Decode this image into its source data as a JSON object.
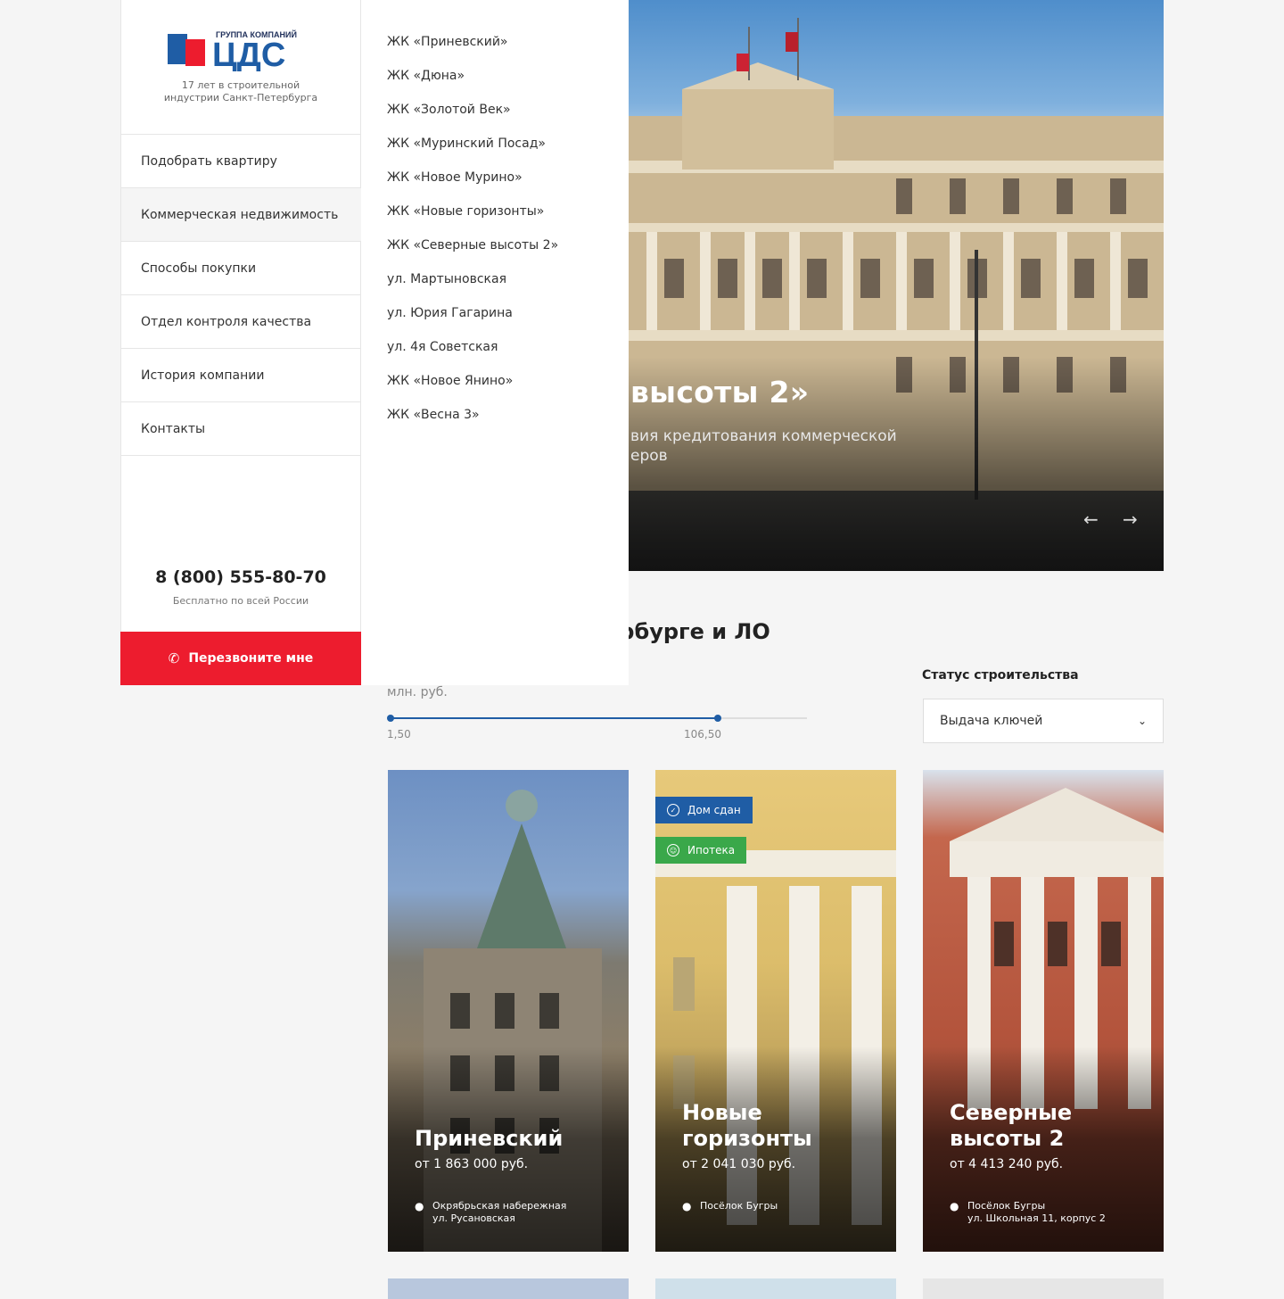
{
  "brand": {
    "logo_caption": "ГРУППА КОМПАНИЙ",
    "logo_mark": "ЦДС",
    "tagline": "17 лет в строительной индустрии Санкт-Петербурга",
    "colors": {
      "primary": "#1f5da5",
      "accent": "#ed1c2e",
      "success": "#3aa84a"
    }
  },
  "sidebar": {
    "items": [
      {
        "label": "Подобрать квартиру"
      },
      {
        "label": "Коммерческая недвижимость"
      },
      {
        "label": "Способы покупки"
      },
      {
        "label": "Отдел контроля качества"
      },
      {
        "label": "История компании"
      },
      {
        "label": "Контакты"
      }
    ],
    "phone": "8 (800) 555-80-70",
    "phone_note": "Бесплатно по всей России",
    "callback_label": "Перезвоните мне",
    "callback_icon": "phone-icon"
  },
  "submenu": {
    "items": [
      "ЖК «Приневский»",
      "ЖК «Дюна»",
      "ЖК «Золотой Век»",
      "ЖК «Муринский Посад»",
      "ЖК «Новое Мурино»",
      "ЖК «Новые горизонты»",
      "ЖК «Северные высоты 2»",
      "ул. Мартыновская",
      "ул. Юрия Гагарина",
      "ул. 4я Советская",
      "ЖК «Новое Янино»",
      "ЖК «Весна 3»"
    ]
  },
  "hero": {
    "title_fragment": "высоты 2»",
    "subtitle_line1": "вия кредитования коммерческой",
    "subtitle_line2": "еров",
    "prev_icon": "arrow-left-icon",
    "next_icon": "arrow-right-icon"
  },
  "filters": {
    "section_title_fragment": "ербурге и ЛО",
    "price_unit": "млн. руб.",
    "price_min": "1,50",
    "price_max": "106,50",
    "price_range_fraction": 0.785,
    "status_label": "Статус строительства",
    "status_value": "Выдача ключей"
  },
  "cards": [
    {
      "name": "Приневский",
      "price": "от 1 863 000 руб.",
      "address_line1": "Окрябрьская набережная",
      "address_line2": "ул. Русановская"
    },
    {
      "name": "Новые горизонты",
      "price": "от 2 041 030 руб.",
      "address_line1": "Посёлок Бугры",
      "address_line2": "",
      "badges": [
        "Дом сдан",
        "Ипотека"
      ]
    },
    {
      "name": "Северные высоты 2",
      "price": "от 4 413 240 руб.",
      "address_line1": "Посёлок Бугры",
      "address_line2": "ул. Школьная 11, корпус 2"
    }
  ]
}
